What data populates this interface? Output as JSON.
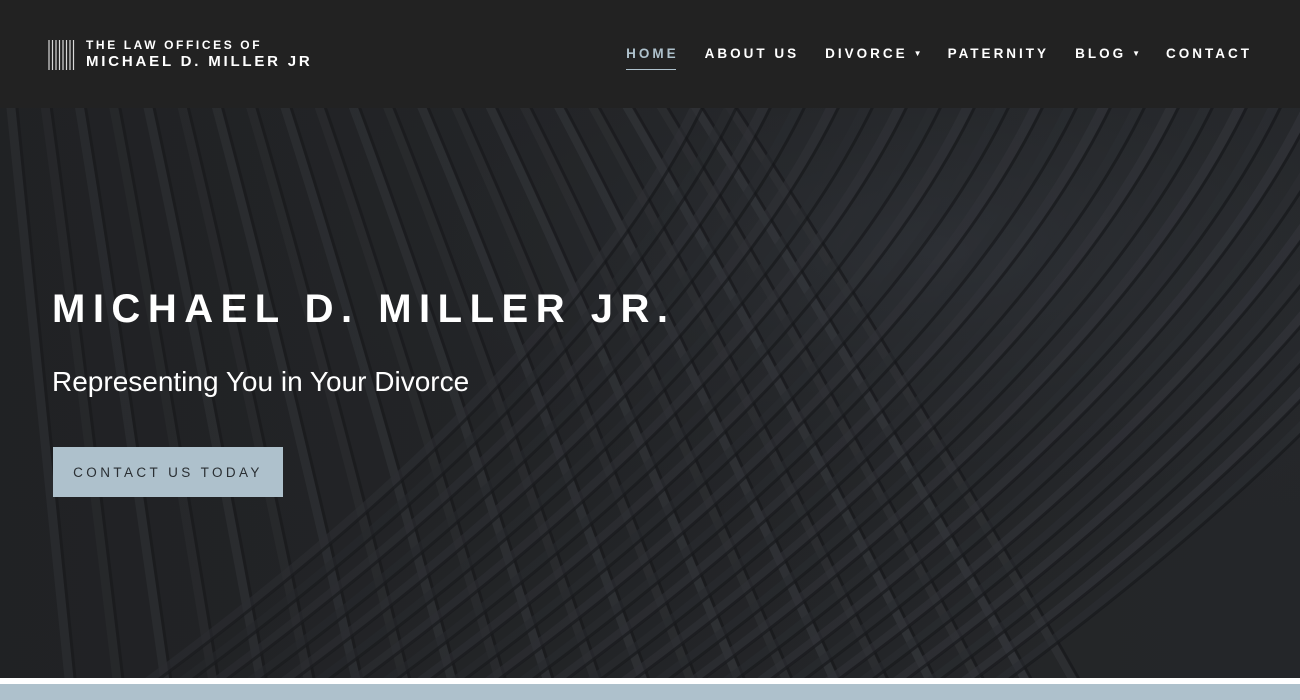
{
  "logo": {
    "line1": "THE LAW OFFICES OF",
    "line2": "MICHAEL D. MILLER JR"
  },
  "nav": {
    "items": [
      {
        "label": "HOME",
        "active": true,
        "has_dropdown": false
      },
      {
        "label": "ABOUT US",
        "active": false,
        "has_dropdown": false
      },
      {
        "label": "DIVORCE",
        "active": false,
        "has_dropdown": true
      },
      {
        "label": "PATERNITY",
        "active": false,
        "has_dropdown": false
      },
      {
        "label": "BLOG",
        "active": false,
        "has_dropdown": true
      },
      {
        "label": "CONTACT",
        "active": false,
        "has_dropdown": false
      }
    ],
    "caret_glyph": "▼"
  },
  "hero": {
    "title": "MICHAEL D. MILLER JR.",
    "subtitle": "Representing You in Your Divorce",
    "cta_label": "CONTACT US TODAY"
  },
  "colors": {
    "header_bg": "#222222",
    "accent": "#aec1cc",
    "hero_bg": "#232527",
    "text": "#ffffff"
  },
  "icons": {
    "logo_mark": "vertical-bars-icon",
    "dropdown": "caret-down-icon"
  }
}
